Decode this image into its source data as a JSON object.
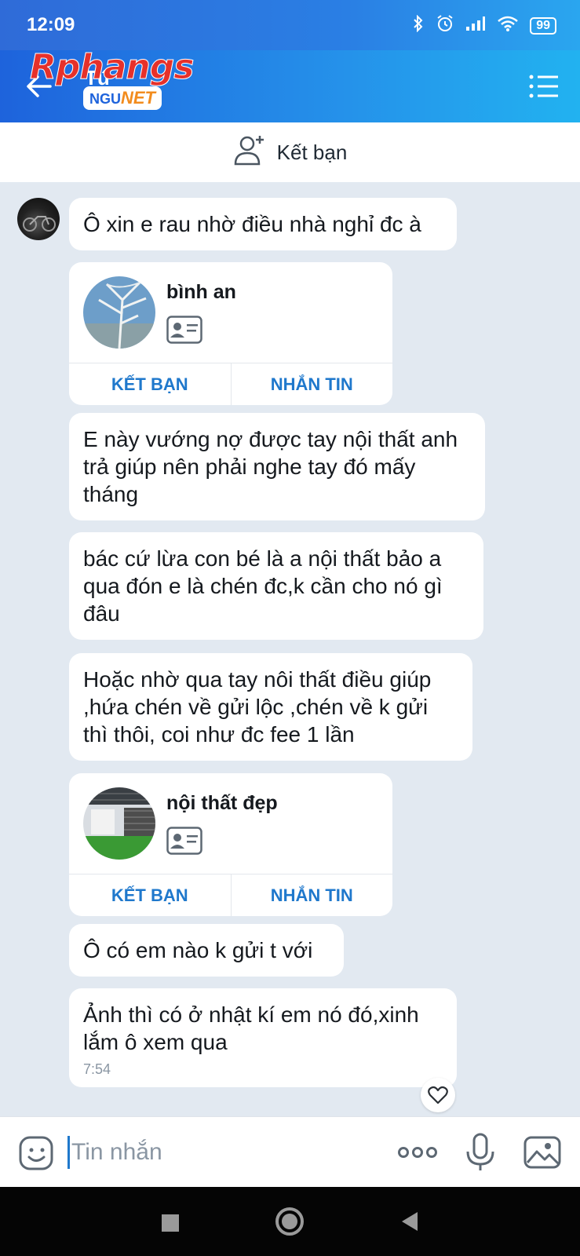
{
  "status_bar": {
    "time": "12:09",
    "battery": "99"
  },
  "header": {
    "title": "Tú",
    "watermark_top": "Rphangs",
    "watermark_badge_left": "NGU",
    "watermark_badge_right": "NET"
  },
  "add_friend_bar": {
    "label": "Kết bạn"
  },
  "messages": [
    {
      "text": "Ô xin e rau nhờ điều nhà nghỉ đc à"
    },
    {
      "type": "contact_card",
      "name": "bình an",
      "actions": [
        "KẾT BẠN",
        "NHẮN TIN"
      ]
    },
    {
      "text": "E này vướng nợ được tay nội thất anh trả giúp nên phải nghe tay đó mấy tháng"
    },
    {
      "text": "bác cứ lừa con bé là a nội thất bảo a qua đón e là chén đc,k cần cho nó gì đâu"
    },
    {
      "text": "Hoặc nhờ qua tay nôi thất điều giúp ,hứa chén về gửi lộc ,chén về k gửi thì thôi, coi như đc fee 1 lần"
    },
    {
      "type": "contact_card",
      "name": "nội thất đẹp",
      "actions": [
        "KẾT BẠN",
        "NHẮN TIN"
      ]
    },
    {
      "text": "Ô có em nào k gửi t với"
    },
    {
      "text": "Ảnh thì có ở nhật kí em nó đó,xinh lắm ô xem qua",
      "time": "7:54"
    }
  ],
  "input_bar": {
    "placeholder": "Tin nhắn"
  },
  "colors": {
    "header_start": "#1e63dc",
    "header_end": "#22b2f0",
    "accent": "#1f78cc",
    "chat_bg": "#e2e9f1"
  },
  "icons": [
    "back-arrow-icon",
    "menu-list-icon",
    "add-friend-icon",
    "contact-card-icon",
    "heart-icon",
    "emoji-icon",
    "more-dots-icon",
    "microphone-icon",
    "image-icon",
    "nav-square-icon",
    "nav-circle-icon",
    "nav-back-triangle-icon"
  ]
}
